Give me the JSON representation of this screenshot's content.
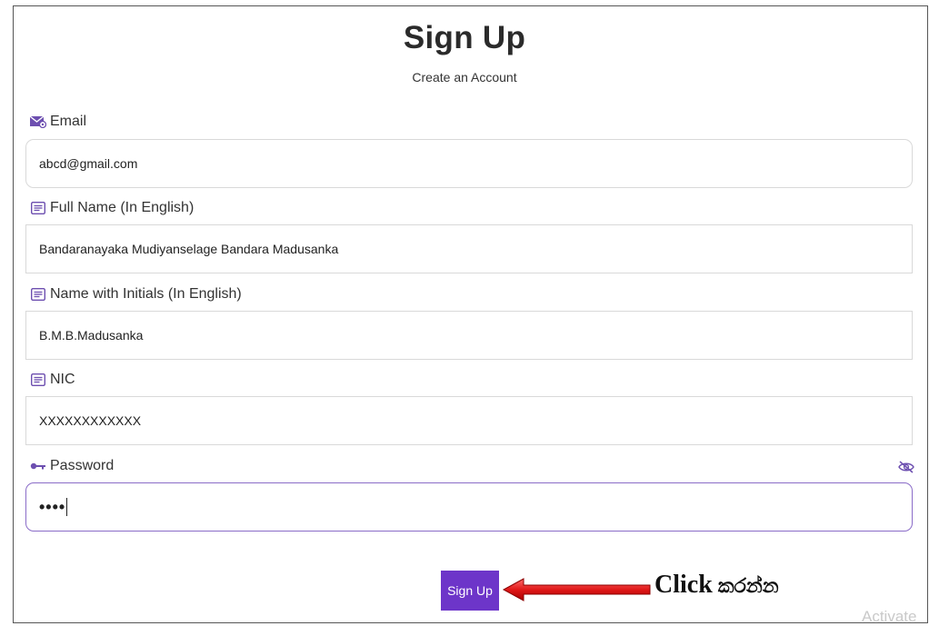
{
  "header": {
    "title": "Sign Up",
    "subtitle": "Create an Account"
  },
  "form": {
    "email": {
      "label": "Email",
      "value": "abcd@gmail.com",
      "icon": "email-icon"
    },
    "full_name": {
      "label": "Full Name (In English)",
      "value": "Bandaranayaka Mudiyanselage Bandara Madusanka",
      "icon": "form-icon"
    },
    "name_initials": {
      "label": "Name with Initials (In English)",
      "value": "B.M.B.Madusanka",
      "icon": "form-icon"
    },
    "nic": {
      "label": "NIC",
      "value": "XXXXXXXXXXXX",
      "icon": "form-icon"
    },
    "password": {
      "label": "Password",
      "value": "••••",
      "icon": "key-icon",
      "toggle_icon": "eye-slash-icon"
    }
  },
  "actions": {
    "signup_label": "Sign Up"
  },
  "annotation": {
    "click_text": "Click",
    "sinhala_text": "කරන්න"
  },
  "watermark": "Activate",
  "colors": {
    "accent": "#6d35c9",
    "focus_border": "#8a6cc8",
    "arrow": "#e02020"
  }
}
